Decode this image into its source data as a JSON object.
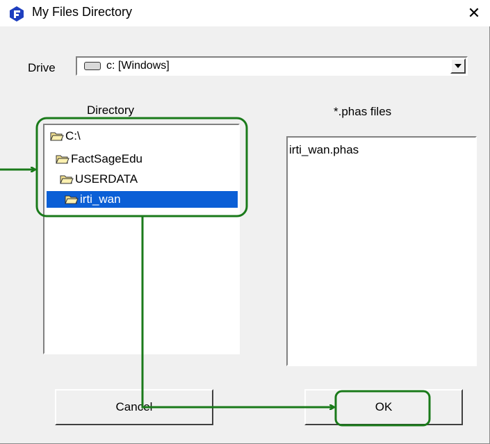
{
  "window": {
    "title": "My Files Directory",
    "close_glyph": "✕"
  },
  "icons": {
    "app": "factsage-logo-icon",
    "close": "close-icon",
    "drive": "drive-icon",
    "folder": "folder-icon",
    "dropdown": "chevron-down-icon"
  },
  "drive": {
    "label": "Drive",
    "value": "c: [Windows]"
  },
  "directory": {
    "label": "Directory",
    "items": [
      {
        "name": "C:\\"
      },
      {
        "name": "FactSageEdu"
      },
      {
        "name": "USERDATA"
      },
      {
        "name": "irti_wan",
        "selected": true
      }
    ]
  },
  "files": {
    "label": "*.phas files",
    "items": [
      "irti_wan.phas"
    ]
  },
  "buttons": {
    "cancel": "Cancel",
    "ok": "OK"
  },
  "colors": {
    "annotation": "#1a7a1a",
    "selection": "#0b5fd6"
  }
}
